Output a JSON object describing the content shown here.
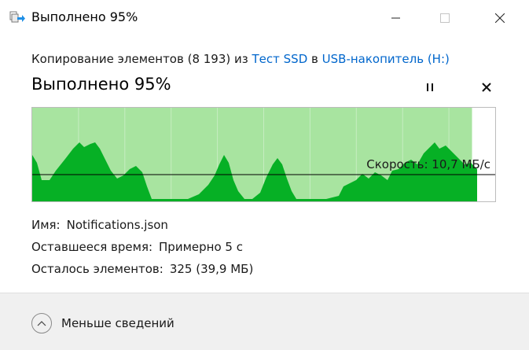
{
  "window": {
    "title": "Выполнено 95%",
    "icon": "copy-files-icon"
  },
  "header": {
    "prefix": "Копирование элементов (8 193) из",
    "source": "Тест SSD",
    "middle": "в",
    "destination": "USB-накопитель (H:)",
    "link_color": "#0066cc"
  },
  "progress": {
    "title": "Выполнено 95%",
    "percent": 95,
    "speed_label": "Скорость: 10,7 МБ/с",
    "fill_color": "#a8e4a0",
    "graph_color": "#06b025"
  },
  "details": {
    "name_label": "Имя:",
    "name_value": "Notifications.json",
    "time_label": "Оставшееся время:",
    "time_value": "Примерно 5 с",
    "items_label": "Осталось элементов:",
    "items_value": "325 (39,9 МБ)"
  },
  "footer": {
    "toggle_label": "Меньше сведений"
  }
}
